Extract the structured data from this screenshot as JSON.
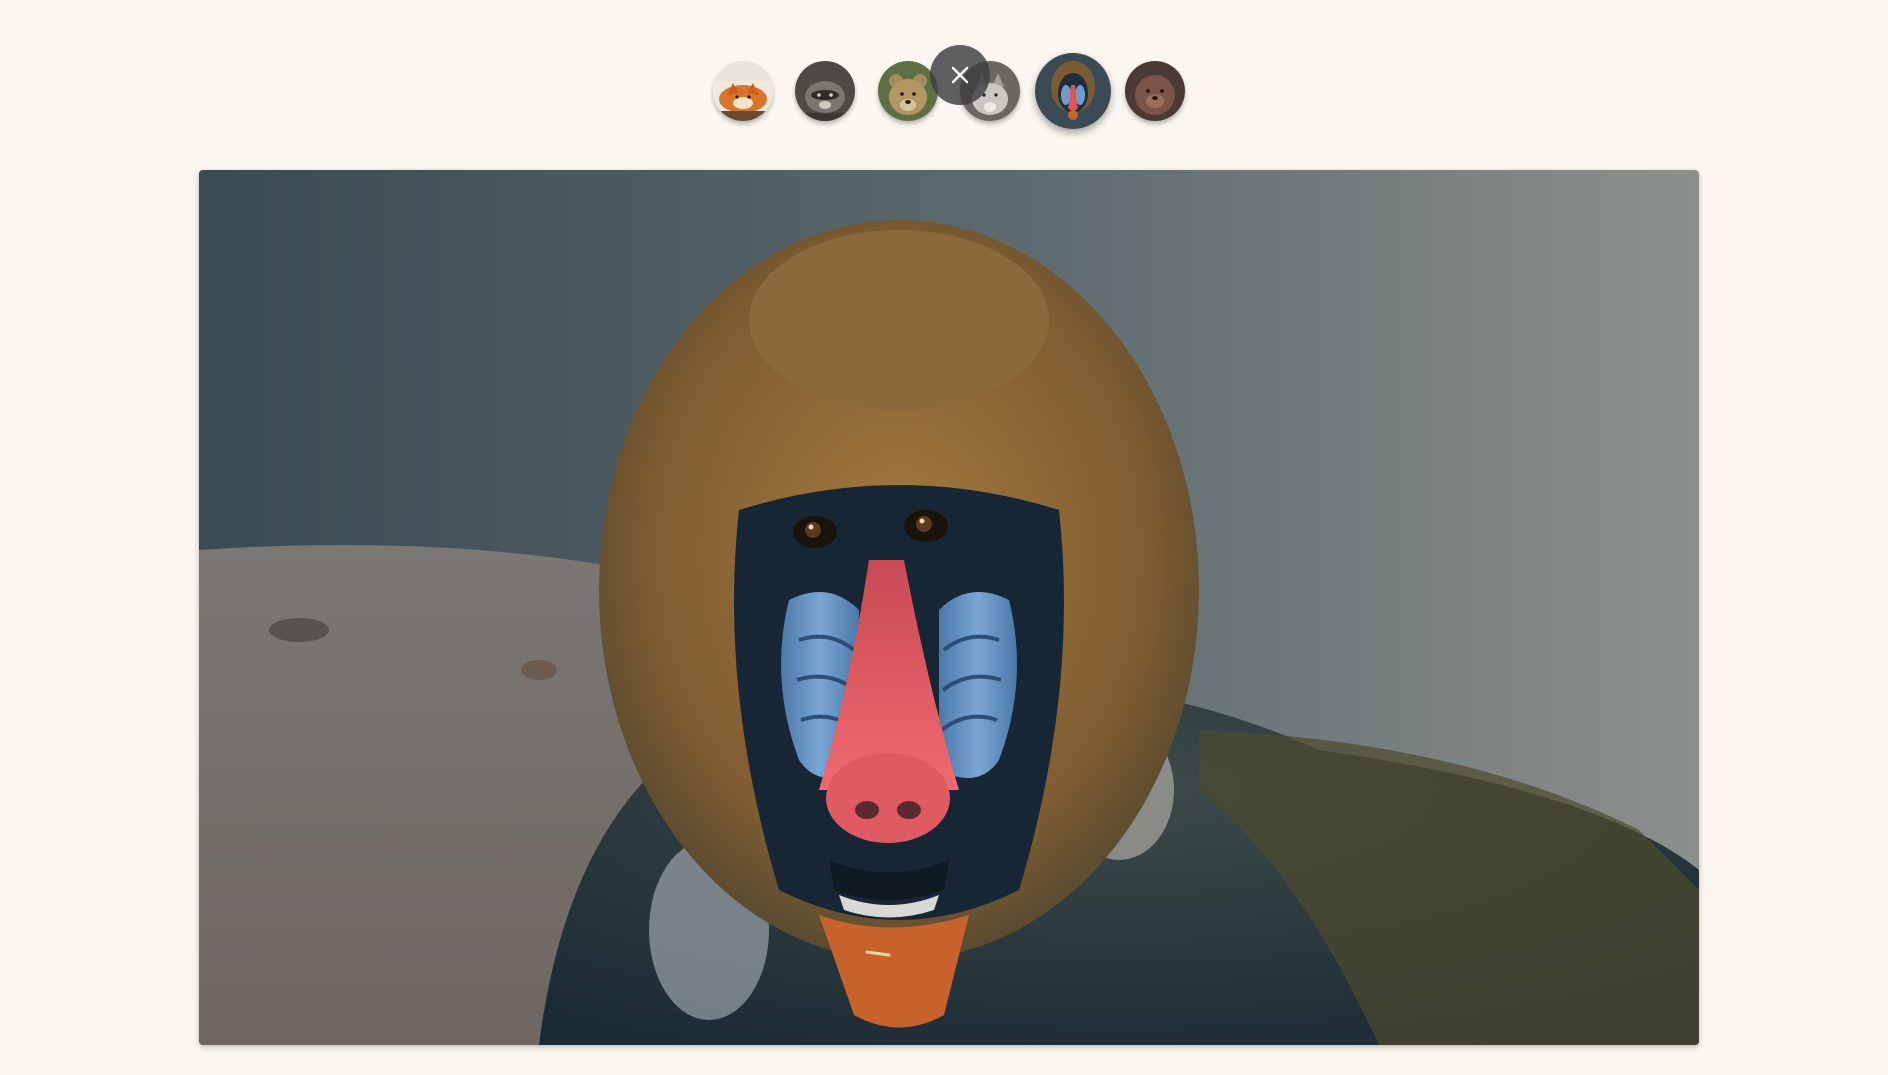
{
  "gallery": {
    "thumbnails": [
      {
        "subject": "fox",
        "selected": false
      },
      {
        "subject": "raccoon",
        "selected": false
      },
      {
        "subject": "bear",
        "selected": false
      },
      {
        "subject": "wolf",
        "selected": false
      },
      {
        "subject": "mandrill",
        "selected": true
      },
      {
        "subject": "beaver",
        "selected": false
      }
    ],
    "close_icon": "close-icon",
    "main_image_subject": "mandrill"
  },
  "colors": {
    "page_background": "#fbf7f0",
    "close_button": "#3c3c40",
    "mandrill_nose": "#e2545c",
    "mandrill_cheeks": "#6f9ccd",
    "mandrill_fur": "#8a6a3a",
    "mandrill_beard": "#c8622c"
  }
}
